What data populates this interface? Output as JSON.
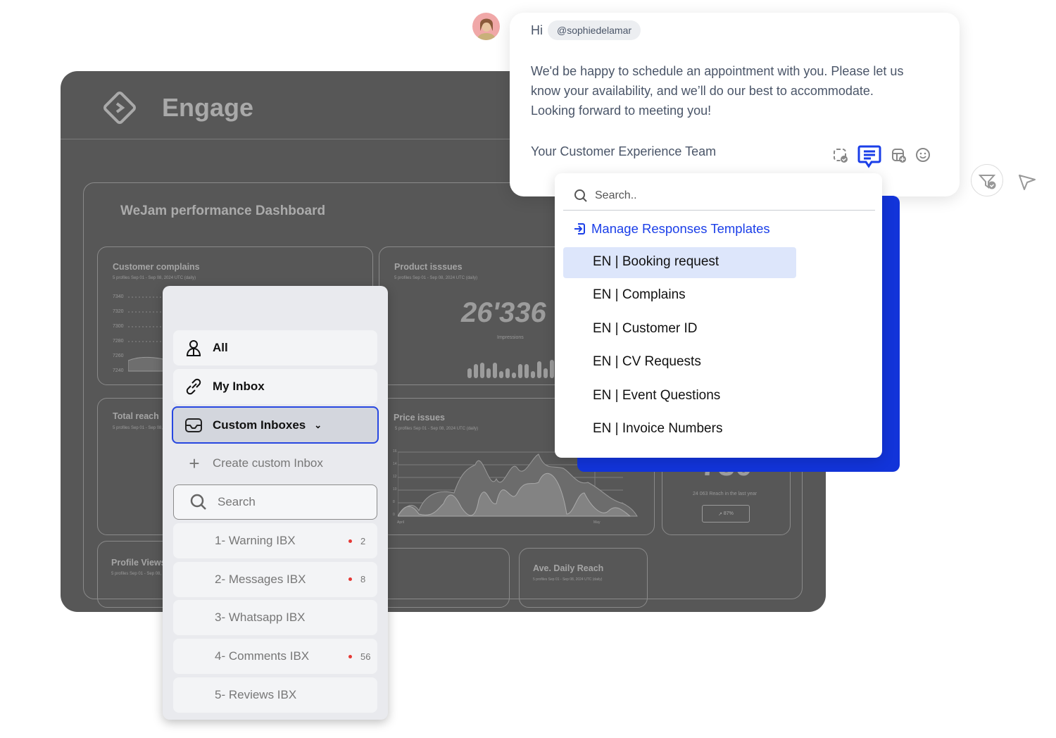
{
  "dashboard": {
    "brand": "Engage",
    "title": "WeJam performance Dashboard",
    "meta": "5 profiles   Sep 01 - Sep 08, 2024 UTC (daily)",
    "cards": {
      "complains": {
        "title": "Customer complains",
        "yticks": [
          "7340",
          "7320",
          "7300",
          "7280",
          "7260",
          "7240"
        ]
      },
      "product": {
        "title": "Product isssues",
        "value": "26'336",
        "sub": "Impressions"
      },
      "total_reach": {
        "title": "Total reach"
      },
      "price": {
        "title": "Price issues",
        "yticks": [
          "16",
          "14",
          "12",
          "10",
          "8",
          "0"
        ],
        "xticks": [
          "April",
          "May"
        ]
      },
      "reach": {
        "value": "730",
        "sub": "24 063 Reach in the last year",
        "badge": "87%"
      },
      "profile_views": {
        "title": "Profile Views"
      },
      "daily_reach": {
        "title": "Ave. Daily Reach"
      }
    }
  },
  "inbox": {
    "all": "All",
    "my_inbox": "My Inbox",
    "custom": "Custom Inboxes",
    "create": "Create custom Inbox",
    "search_placeholder": "Search",
    "items": [
      {
        "label": "1- Warning IBX",
        "count": "2",
        "unread": true
      },
      {
        "label": "2- Messages IBX",
        "count": "8",
        "unread": true
      },
      {
        "label": "3- Whatsapp IBX",
        "count": "",
        "unread": false
      },
      {
        "label": "4- Comments IBX",
        "count": "56",
        "unread": true
      },
      {
        "label": "5- Reviews IBX",
        "count": "",
        "unread": false
      }
    ]
  },
  "message": {
    "greeting": "Hi",
    "mention": "@sophiedelamar",
    "lines": [
      "We'd be happy to schedule an appointment with you. Please let us",
      "know your availability, and we’ll do our best to accommodate.",
      "Looking forward to meeting you!"
    ],
    "signature": "Your Customer Experience Team"
  },
  "templates": {
    "search_placeholder": "Search..",
    "manage": "Manage Responses Templates",
    "selected": 0,
    "items": [
      "EN | Booking request",
      "EN | Complains",
      "EN | Customer ID",
      "EN | CV Requests",
      "EN | Event Questions",
      "EN | Invoice Numbers"
    ]
  },
  "colors": {
    "accent": "#1a3ee8",
    "selected_bg": "#dde6fb",
    "dashboard_bg": "#575757",
    "unread_dot": "#e53935"
  }
}
